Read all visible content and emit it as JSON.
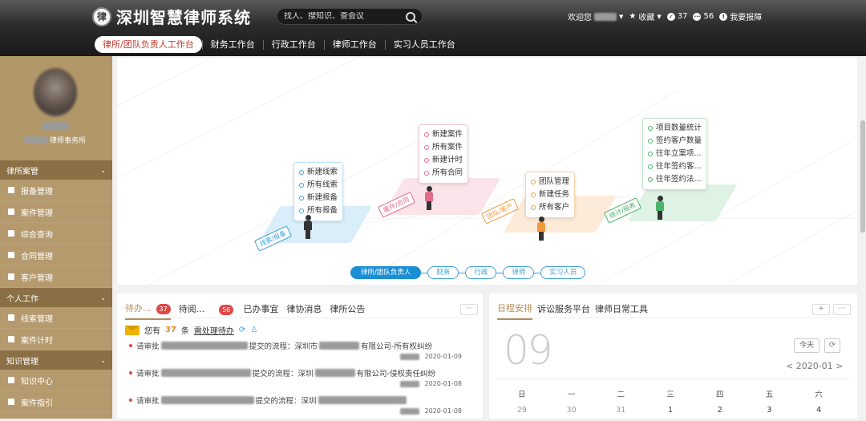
{
  "header": {
    "logo_text": "深圳智慧律师系统",
    "search_placeholder": "找人、搜知识、查会议",
    "welcome": "欢迎您",
    "favorites": "收藏",
    "count1": "37",
    "count2": "56",
    "report": "我要报障"
  },
  "nav": {
    "tabs": [
      "律所/团队负责人工作台",
      "财务工作台",
      "行政工作台",
      "律师工作台",
      "实习人员工作台"
    ]
  },
  "sidebar": {
    "firm_suffix": "律师事务所",
    "sections": [
      {
        "title": "律所案管",
        "items": [
          "报备管理",
          "案件管理",
          "综合查询",
          "合同管理",
          "客户管理"
        ]
      },
      {
        "title": "个人工作",
        "items": [
          "线索管理",
          "案件计时"
        ]
      },
      {
        "title": "知识管理",
        "items": [
          "知识中心",
          "案件指引"
        ]
      }
    ]
  },
  "hero": {
    "bubble_leads": [
      "新建线索",
      "所有线索",
      "新建报备",
      "所有报备"
    ],
    "bubble_cases": [
      "新建案件",
      "所有案件",
      "新建计时",
      "所有合同"
    ],
    "bubble_team": [
      "团队管理",
      "新建任务",
      "所有客户"
    ],
    "bubble_stats": [
      "项目数量统计",
      "签约客户数量",
      "往年立案项...",
      "往年签约客...",
      "往年签约法..."
    ],
    "tag1": "线索/报备",
    "tag2": "案件/合同",
    "tag3": "团队/客户",
    "tag4": "统计/报表",
    "roles": [
      "律所/团队负责人",
      "财务",
      "行政",
      "律师",
      "实习人员"
    ]
  },
  "tasks": {
    "tabs": [
      "待办...",
      "待阅...",
      "已办事宜",
      "律协消息",
      "律所公告"
    ],
    "badge_todo": "37",
    "badge_read": "56",
    "more": "···",
    "notice_prefix": "您有",
    "notice_count": "37",
    "notice_suffix": "条",
    "notice_link": "需处理待办",
    "rows": [
      {
        "prefix": "请审批",
        "mid": "提交的流程：深圳市",
        "suffix": "有限公司-所有权纠纷",
        "date": "2020-01-09"
      },
      {
        "prefix": "请审批",
        "mid": "提交的流程：深圳",
        "suffix": "有限公司-侵权责任纠纷",
        "date": "2020-01-08"
      },
      {
        "prefix": "请审批",
        "mid": "提交的流程：深圳",
        "suffix": "",
        "date": "2020-01-08"
      }
    ]
  },
  "schedule": {
    "tabs": [
      "日程安排",
      "诉讼服务平台",
      "律师日常工具"
    ],
    "plus": "+",
    "more": "···",
    "day": "09",
    "today": "今天",
    "month": "< 2020-01 >",
    "weekdays": [
      "日",
      "一",
      "二",
      "三",
      "四",
      "五",
      "六"
    ],
    "dates": [
      "29",
      "30",
      "31",
      "1",
      "2",
      "3",
      "4"
    ]
  }
}
